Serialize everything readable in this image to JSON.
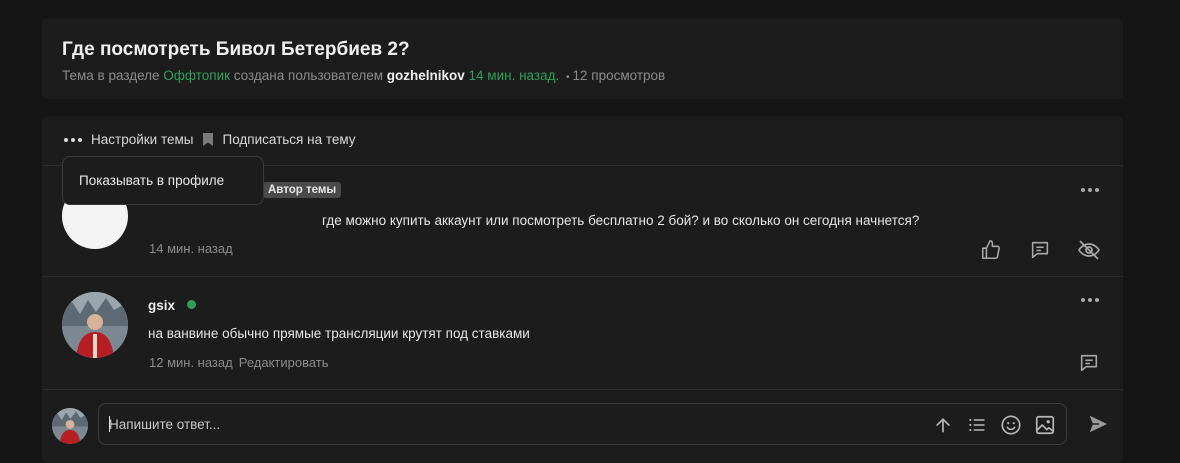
{
  "topic": {
    "title": "Где посмотреть Бивол Бетербиев 2?",
    "meta_prefix": "Тема в разделе ",
    "section": "Оффтопик",
    "meta_created_by": " создана пользователем ",
    "author": "gozhelnikov",
    "time": "14 мин. назад.",
    "views": "12 просмотров"
  },
  "toolbar": {
    "settings_label": "Настройки темы",
    "subscribe_label": "Подписаться на тему"
  },
  "dropdown": {
    "show_in_profile": "Показывать в профиле"
  },
  "posts": [
    {
      "badge": "Автор темы",
      "text": "где можно купить аккаунт или посмотреть бесплатно 2 бой? и во сколько он сегодня начнется?",
      "time": "14 мин. назад"
    },
    {
      "name": "gsix",
      "text": "на ванвине обычно прямые трансляции крутят под ставками",
      "time": "12 мин. назад",
      "edit_label": "Редактировать"
    }
  ],
  "reply": {
    "placeholder": "Напишите ответ..."
  },
  "colors": {
    "accent_green": "#2e9e5a",
    "background": "#151515",
    "card": "#1c1c1c"
  }
}
